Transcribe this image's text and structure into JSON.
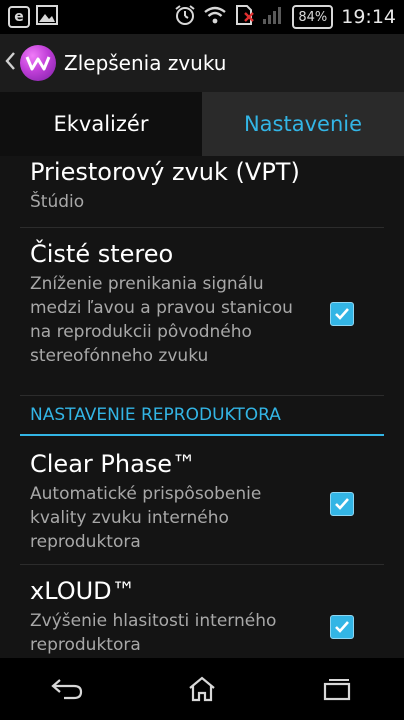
{
  "status_bar": {
    "battery": "84%",
    "time": "19:14"
  },
  "action_bar": {
    "title": "Zlepšenia zvuku"
  },
  "tabs": [
    {
      "label": "Ekvalizér",
      "active": false
    },
    {
      "label": "Nastavenie",
      "active": true
    }
  ],
  "prefs": {
    "vpt": {
      "title": "Priestorový zvuk (VPT)",
      "summary": "Štúdio"
    },
    "clear_stereo": {
      "title": "Čisté stereo",
      "summary": "Zníženie prenikania signálu medzi ľavou a pravou stanicou na reprodukcii pôvodného stereofónneho zvuku",
      "checked": true
    },
    "section_header": "NASTAVENIE REPRODUKTORA",
    "clear_phase": {
      "title": "Clear Phase™",
      "summary": "Automatické prispôsobenie kvality zvuku interného reproduktora",
      "checked": true
    },
    "xloud": {
      "title": "xLOUD™",
      "summary": "Zvýšenie hlasitosti interného reproduktora",
      "checked": true
    }
  },
  "colors": {
    "accent": "#33b5e5",
    "background": "#141414"
  }
}
